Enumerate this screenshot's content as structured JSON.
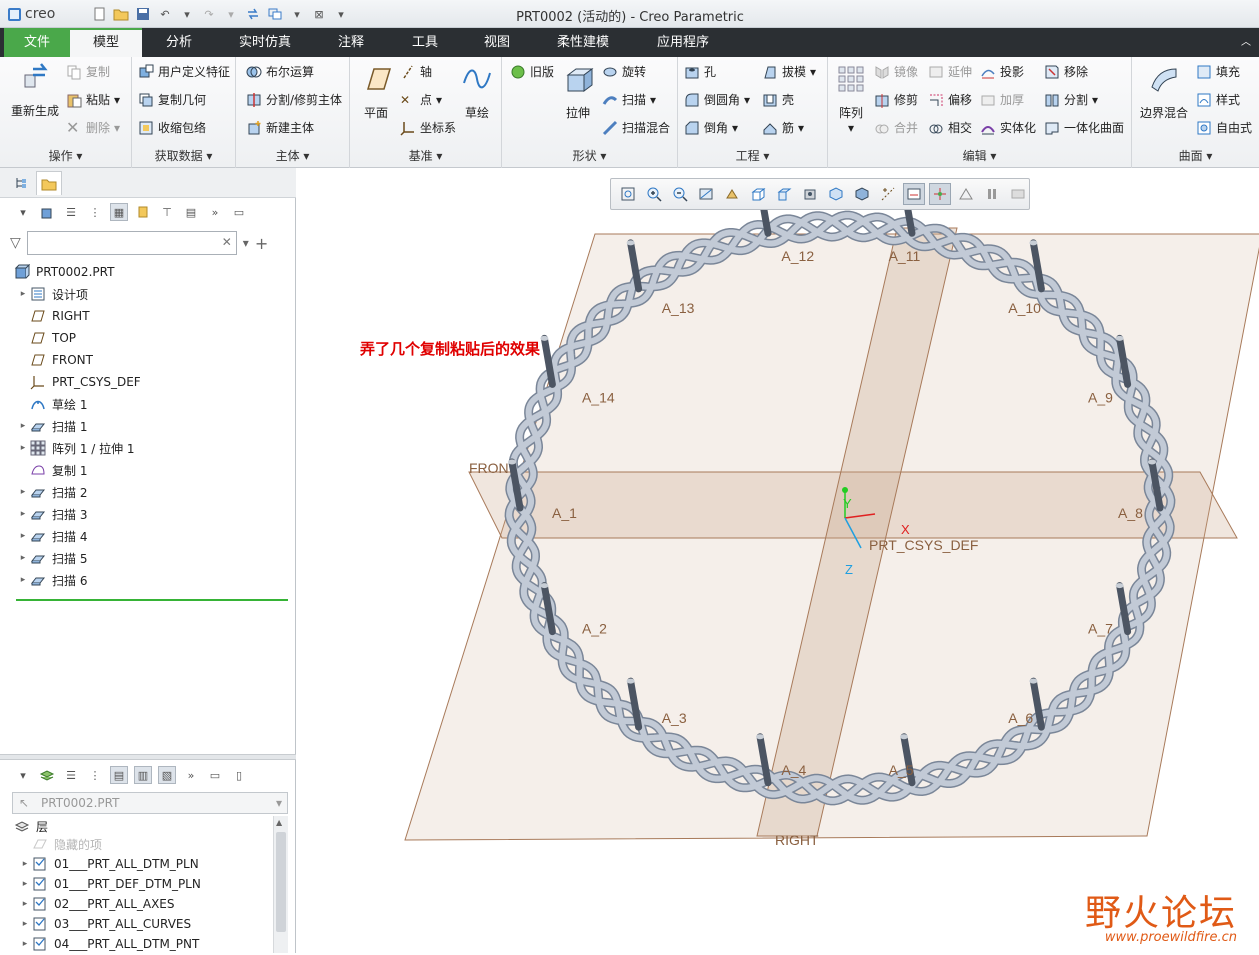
{
  "app": {
    "logo_text": "creo",
    "window_title": "PRT0002 (活动的) - Creo Parametric"
  },
  "tabs": [
    "文件",
    "模型",
    "分析",
    "实时仿真",
    "注释",
    "工具",
    "视图",
    "柔性建模",
    "应用程序"
  ],
  "ribbon": {
    "operations": {
      "label": "操作",
      "regenerate": "重新生成",
      "copy": "复制",
      "paste": "粘贴",
      "delete": "删除"
    },
    "get_data": {
      "label": "获取数据",
      "udf": "用户定义特征",
      "copy_geom": "复制几何",
      "shrinkwrap": "收缩包络"
    },
    "body": {
      "label": "主体",
      "boolean": "布尔运算",
      "split_trim": "分割/修剪主体",
      "new_body": "新建主体"
    },
    "datum": {
      "label": "基准",
      "plane": "平面",
      "axis": "轴",
      "point": "点",
      "csys": "坐标系",
      "sketch": "草绘"
    },
    "shapes": {
      "label": "形状",
      "legacy": "旧版",
      "extrude": "拉伸",
      "revolve": "旋转",
      "sweep": "扫描",
      "swept_blend": "扫描混合"
    },
    "engineering": {
      "label": "工程",
      "hole": "孔",
      "draft": "拔模",
      "round": "倒圆角",
      "shell": "壳",
      "chamfer": "倒角",
      "rib": "筋"
    },
    "editing": {
      "label": "编辑",
      "pattern": "阵列",
      "mirror": "镜像",
      "extend": "延伸",
      "project": "投影",
      "move": "移除",
      "trim": "修剪",
      "offset": "偏移",
      "thicken": "加厚",
      "split": "分割",
      "merge": "合并",
      "intersect": "相交",
      "solidify": "实体化",
      "unified_surface": "一体化曲面"
    },
    "surfaces": {
      "label": "曲面",
      "boundary_blend": "边界混合",
      "fill": "填充",
      "style": "样式",
      "freestyle": "自由式"
    }
  },
  "model_tree": {
    "filter_placeholder": "",
    "items": [
      {
        "label": "PRT0002.PRT",
        "icon": "part-icon",
        "expandable": false
      },
      {
        "label": "设计项",
        "icon": "design-items-icon",
        "expandable": true
      },
      {
        "label": "RIGHT",
        "icon": "datum-plane-icon",
        "expandable": false
      },
      {
        "label": "TOP",
        "icon": "datum-plane-icon",
        "expandable": false
      },
      {
        "label": "FRONT",
        "icon": "datum-plane-icon",
        "expandable": false
      },
      {
        "label": "PRT_CSYS_DEF",
        "icon": "csys-icon",
        "expandable": false
      },
      {
        "label": "草绘 1",
        "icon": "sketch-icon",
        "expandable": false
      },
      {
        "label": "扫描 1",
        "icon": "sweep-icon",
        "expandable": true
      },
      {
        "label": "阵列 1 / 拉伸 1",
        "icon": "pattern-icon",
        "expandable": true
      },
      {
        "label": "复制 1",
        "icon": "copy-feature-icon",
        "expandable": false
      },
      {
        "label": "扫描 2",
        "icon": "sweep-icon",
        "expandable": true
      },
      {
        "label": "扫描 3",
        "icon": "sweep-icon",
        "expandable": true
      },
      {
        "label": "扫描 4",
        "icon": "sweep-icon",
        "expandable": true
      },
      {
        "label": "扫描 5",
        "icon": "sweep-icon",
        "expandable": true
      },
      {
        "label": "扫描 6",
        "icon": "sweep-icon",
        "expandable": true
      }
    ]
  },
  "layer_tree": {
    "model_select": "PRT0002.PRT",
    "root": "层",
    "items": [
      {
        "label": "隐藏的项",
        "muted": true
      },
      {
        "label": "01___PRT_ALL_DTM_PLN",
        "muted": false
      },
      {
        "label": "01___PRT_DEF_DTM_PLN",
        "muted": false
      },
      {
        "label": "02___PRT_ALL_AXES",
        "muted": false
      },
      {
        "label": "03___PRT_ALL_CURVES",
        "muted": false
      },
      {
        "label": "04___PRT_ALL_DTM_PNT",
        "muted": false
      }
    ]
  },
  "viewport": {
    "annotation": "弄了几个复制粘贴后的效果",
    "plane_labels": {
      "front": "FRONT",
      "right": "RIGHT"
    },
    "csys_label": "PRT_CSYS_DEF",
    "axis_labels": {
      "x": "X",
      "y": "Y",
      "z": "Z"
    },
    "axes": [
      {
        "label": "A_1",
        "angle": 180
      },
      {
        "label": "A_2",
        "angle": 154
      },
      {
        "label": "A_3",
        "angle": 129
      },
      {
        "label": "A_4",
        "angle": 103
      },
      {
        "label": "A_5",
        "angle": 77
      },
      {
        "label": "A_6",
        "angle": 51
      },
      {
        "label": "A_7",
        "angle": 26
      },
      {
        "label": "A_8",
        "angle": 0
      },
      {
        "label": "A_9",
        "angle": -26
      },
      {
        "label": "A_10",
        "angle": -51
      },
      {
        "label": "A_11",
        "angle": -77
      },
      {
        "label": "A_12",
        "angle": -103
      },
      {
        "label": "A_13",
        "angle": -129
      },
      {
        "label": "A_14",
        "angle": -154
      }
    ]
  },
  "watermark": {
    "main": "野火论坛",
    "sub": "www.proewildfire.cn"
  },
  "colors": {
    "accent": "#4aa84a",
    "tab_bar": "#2b2f33",
    "annotation": "#e00000",
    "datum_plane": "#c8a58a",
    "braid": "#a8b2c0",
    "watermark": "#e05a16"
  }
}
